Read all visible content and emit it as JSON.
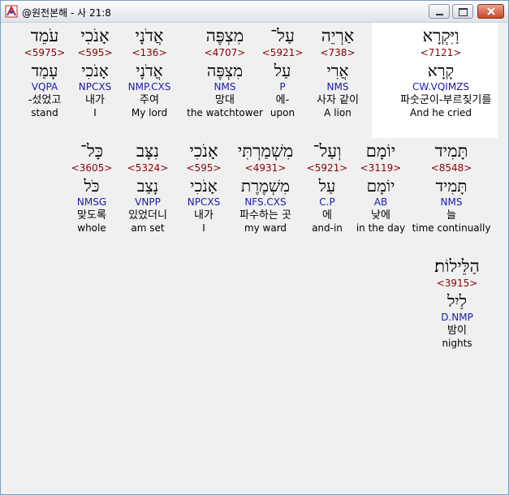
{
  "window": {
    "title": "@원전본해 - 사 21:8"
  },
  "rows": [
    [
      {
        "heb": "וַיִּקְרָא",
        "strong": "<7121>",
        "lemma": "קָרָא",
        "morph": "CW.VQIMZS",
        "kor": "파숫군이-부르짖기를",
        "eng": "And he cried",
        "selected": true
      },
      {
        "heb": "אַרְיֵה",
        "strong": "<738>",
        "lemma": "אֲרִי",
        "morph": "NMS",
        "kor": "사자 같이",
        "eng": "A lion"
      },
      {
        "heb": "עַל־",
        "strong": "<5921>",
        "lemma": "עַל",
        "morph": "P",
        "kor": "에-",
        "eng": "upon"
      },
      {
        "heb": "מִצְפֶּה",
        "strong": "<4707>",
        "lemma": "מִצְפֶּה",
        "morph": "NMS",
        "kor": "망대",
        "eng": "the watchtower"
      },
      {
        "heb": "אֲדֹנָי",
        "strong": "<136>",
        "lemma": "אֲדֹנָי",
        "morph": "NMP.CXS",
        "kor": "주여",
        "eng": "My lord"
      },
      {
        "heb": "אָנֹכִי",
        "strong": "<595>",
        "lemma": "אָנֹכִי",
        "morph": "NPCXS",
        "kor": "내가",
        "eng": "I"
      },
      {
        "heb": "עֹמֵד",
        "strong": "<5975>",
        "lemma": "עָמַד",
        "morph": "VQPA",
        "kor": "-섰었고",
        "eng": "stand"
      }
    ],
    [
      {
        "heb": "תָּמִיד",
        "strong": "<8548>",
        "lemma": "תָּמִיד",
        "morph": "NMS",
        "kor": "늘",
        "eng": "time continually"
      },
      {
        "heb": "יוֹמָם",
        "strong": "<3119>",
        "lemma": "יוֹמָם",
        "morph": "AB",
        "kor": "낮에",
        "eng": "in the day"
      },
      {
        "heb": "וְעַל־",
        "strong": "<5921>",
        "lemma": "עַל",
        "morph": "C.P",
        "kor": "에",
        "eng": "and-in"
      },
      {
        "heb": "מִשְׁמַרְתִּי",
        "strong": "<4931>",
        "lemma": "מִשְׁמֶרֶת",
        "morph": "NFS.CXS",
        "kor": "파수하는 곳",
        "eng": "my ward"
      },
      {
        "heb": "אָנֹכִי",
        "strong": "<595>",
        "lemma": "אָנֹכִי",
        "morph": "NPCXS",
        "kor": "내가",
        "eng": "I"
      },
      {
        "heb": "נִצָּב",
        "strong": "<5324>",
        "lemma": "נָצַב",
        "morph": "VNPP",
        "kor": "있었더니",
        "eng": "am set"
      },
      {
        "heb": "כָּל־",
        "strong": "<3605>",
        "lemma": "כֹּל",
        "morph": "NMSG",
        "kor": "맞도록",
        "eng": "whole"
      }
    ],
    [
      {
        "heb": "הַלֵּילוֹת׃",
        "strong": "<3915>",
        "lemma": "לַיִל",
        "morph": "D.NMP",
        "kor": "밤이",
        "eng": "nights"
      }
    ]
  ]
}
